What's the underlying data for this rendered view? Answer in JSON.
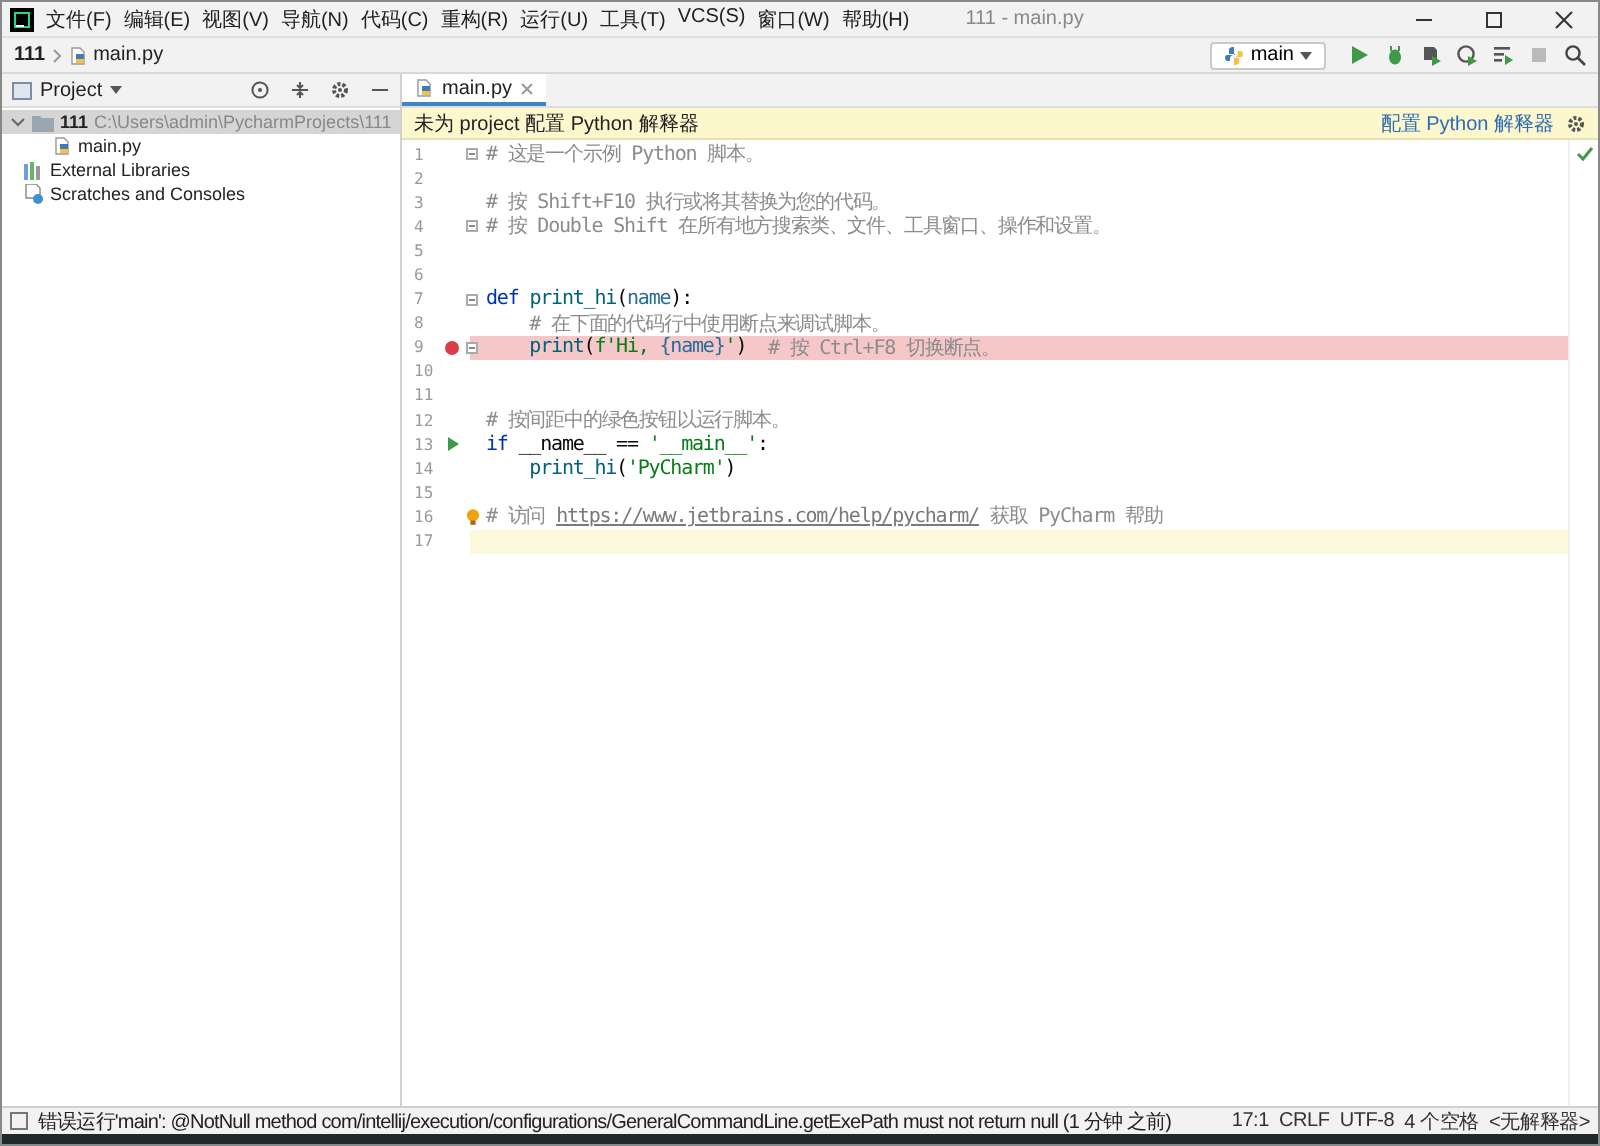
{
  "window": {
    "title": "111 - main.py"
  },
  "menu": [
    "文件(F)",
    "编辑(E)",
    "视图(V)",
    "导航(N)",
    "代码(C)",
    "重构(R)",
    "运行(U)",
    "工具(T)",
    "VCS(S)",
    "窗口(W)",
    "帮助(H)"
  ],
  "breadcrumb": [
    "111",
    "main.py"
  ],
  "run_config": {
    "label": "main"
  },
  "toolbar": [
    {
      "kind": "run",
      "disabled": false
    },
    {
      "kind": "debug",
      "disabled": false
    },
    {
      "kind": "coverage",
      "disabled": false
    },
    {
      "kind": "profile",
      "disabled": false
    },
    {
      "kind": "build",
      "disabled": false
    },
    {
      "kind": "stop",
      "disabled": true
    }
  ],
  "project_panel": {
    "title": "Project",
    "tree": [
      {
        "name": "111",
        "path": "C:\\Users\\admin\\PycharmProjects\\111",
        "kind": "folder",
        "expanded": true,
        "selected": true,
        "children": [
          {
            "name": "main.py",
            "kind": "python",
            "selected": false
          }
        ]
      },
      {
        "name": "External Libraries",
        "kind": "library",
        "selected": false
      },
      {
        "name": "Scratches and Consoles",
        "kind": "scratch",
        "selected": false
      }
    ]
  },
  "editor": {
    "tabs": [
      {
        "label": "main.py",
        "selected": true
      }
    ],
    "banner": {
      "message": "未为 project 配置 Python 解释器",
      "action": "配置 Python 解释器"
    },
    "lines": [
      {
        "number": "1",
        "fold": true,
        "breakpoint": false,
        "run_marker": false,
        "current": false,
        "bulb": false,
        "tokens": [
          {
            "kind": "comment",
            "text": "# 这是一个示例 Python 脚本。"
          }
        ]
      },
      {
        "number": "2",
        "fold": false,
        "breakpoint": false,
        "run_marker": false,
        "current": false,
        "bulb": false
      },
      {
        "number": "3",
        "fold": false,
        "breakpoint": false,
        "run_marker": false,
        "current": false,
        "bulb": false,
        "tokens": [
          {
            "kind": "comment",
            "text": "# 按 Shift+F10 执行或将其替换为您的代码。"
          }
        ]
      },
      {
        "number": "4",
        "fold": true,
        "breakpoint": false,
        "run_marker": false,
        "current": false,
        "bulb": false,
        "tokens": [
          {
            "kind": "comment",
            "text": "# 按 Double Shift 在所有地方搜索类、文件、工具窗口、操作和设置。"
          }
        ]
      },
      {
        "number": "5",
        "fold": false,
        "breakpoint": false,
        "run_marker": false,
        "current": false,
        "bulb": false
      },
      {
        "number": "6",
        "fold": false,
        "breakpoint": false,
        "run_marker": false,
        "current": false,
        "bulb": false
      },
      {
        "number": "7",
        "fold": true,
        "breakpoint": false,
        "run_marker": false,
        "current": false,
        "bulb": false,
        "tokens": [
          {
            "kind": "keyword",
            "text": "def "
          },
          {
            "kind": "function",
            "text": "print_hi"
          },
          {
            "kind": "plain",
            "text": "("
          },
          {
            "kind": "param",
            "text": "name"
          },
          {
            "kind": "plain",
            "text": "):"
          }
        ]
      },
      {
        "number": "8",
        "fold": false,
        "breakpoint": false,
        "run_marker": false,
        "current": false,
        "bulb": false,
        "tokens": [
          {
            "kind": "comment",
            "text": "    # 在下面的代码行中使用断点来调试脚本。"
          }
        ]
      },
      {
        "number": "9",
        "fold": true,
        "breakpoint": true,
        "run_marker": false,
        "current": false,
        "bulb": false,
        "tokens": [
          {
            "kind": "function",
            "text": "    print"
          },
          {
            "kind": "plain",
            "text": "("
          },
          {
            "kind": "string",
            "text": "f'Hi, "
          },
          {
            "kind": "param",
            "text": "{name}"
          },
          {
            "kind": "string",
            "text": "'"
          },
          {
            "kind": "plain",
            "text": ")  "
          },
          {
            "kind": "comment",
            "text": "# 按 Ctrl+F8 切换断点。"
          }
        ]
      },
      {
        "number": "10",
        "fold": false,
        "breakpoint": false,
        "run_marker": false,
        "current": false,
        "bulb": false
      },
      {
        "number": "11",
        "fold": false,
        "breakpoint": false,
        "run_marker": false,
        "current": false,
        "bulb": false
      },
      {
        "number": "12",
        "fold": false,
        "breakpoint": false,
        "run_marker": false,
        "current": false,
        "bulb": false,
        "tokens": [
          {
            "kind": "comment",
            "text": "# 按间距中的绿色按钮以运行脚本。"
          }
        ]
      },
      {
        "number": "13",
        "fold": false,
        "breakpoint": false,
        "run_marker": true,
        "current": false,
        "bulb": false,
        "tokens": [
          {
            "kind": "keyword",
            "text": "if "
          },
          {
            "kind": "plain",
            "text": "__name__ == "
          },
          {
            "kind": "string",
            "text": "'__main__'"
          },
          {
            "kind": "plain",
            "text": ":"
          }
        ]
      },
      {
        "number": "14",
        "fold": false,
        "breakpoint": false,
        "run_marker": false,
        "current": false,
        "bulb": false,
        "tokens": [
          {
            "kind": "function",
            "text": "    print_hi"
          },
          {
            "kind": "plain",
            "text": "("
          },
          {
            "kind": "string",
            "text": "'PyCharm'"
          },
          {
            "kind": "plain",
            "text": ")"
          }
        ]
      },
      {
        "number": "15",
        "fold": false,
        "breakpoint": false,
        "run_marker": false,
        "current": false,
        "bulb": false
      },
      {
        "number": "16",
        "fold": false,
        "breakpoint": false,
        "run_marker": false,
        "current": false,
        "bulb": true,
        "tokens": [
          {
            "kind": "comment",
            "text": "# 访问 "
          },
          {
            "kind": "link",
            "text": "https://www.jetbrains.com/help/pycharm/"
          },
          {
            "kind": "comment",
            "text": " 获取 PyCharm 帮助"
          }
        ]
      },
      {
        "number": "17",
        "fold": false,
        "breakpoint": false,
        "run_marker": false,
        "current": true,
        "bulb": false
      }
    ]
  },
  "status_bar": {
    "message": "错误运行'main': @NotNull method com/intellij/execution/configurations/GeneralCommandLine.getExePath must not return null (1 分钟 之前)",
    "items": [
      "17:1",
      "CRLF",
      "UTF-8",
      "4 个空格",
      "<无解释器>"
    ]
  }
}
